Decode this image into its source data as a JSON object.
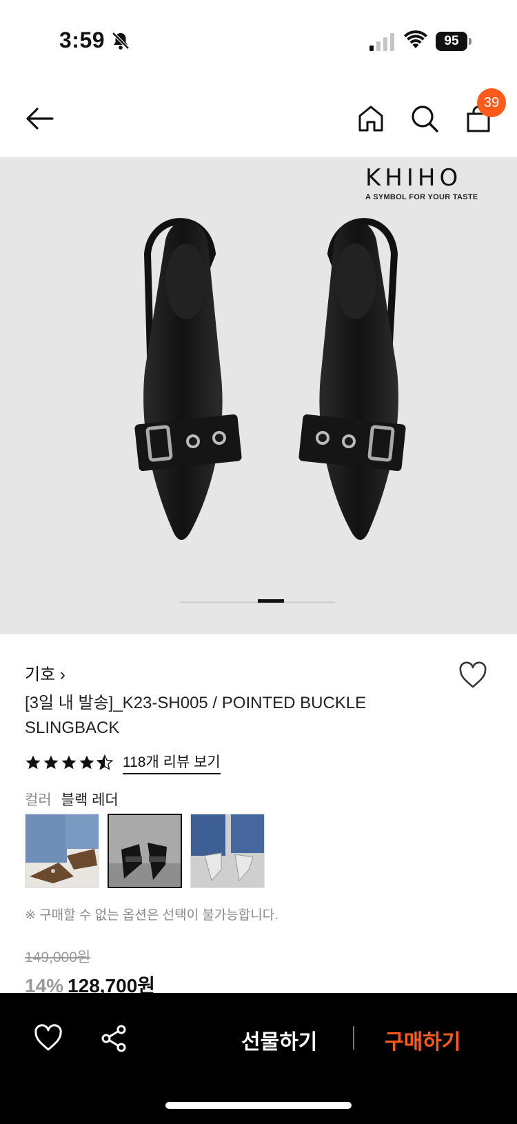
{
  "status": {
    "time": "3:59",
    "battery": "95"
  },
  "nav": {
    "cart_count": "39"
  },
  "hero": {
    "brand_logo": "KHIHO",
    "brand_tagline": "A SYMBOL FOR YOUR TASTE",
    "slide_count_note": "carousel"
  },
  "product": {
    "brand": "기호",
    "brand_chevron": "›",
    "title": "[3일 내 발송]_K23-SH005 / POINTED BUCKLE SLINGBACK",
    "rating": 4.5,
    "review_link": "118개 리뷰 보기",
    "color_label": "컬러",
    "color_value": "블랙 레더",
    "notice": "※ 구매할 수 없는 옵션은 선택이 불가능합니다.",
    "original_price": "149,000원",
    "discount": "14%",
    "sale_price": "128,700원"
  },
  "bottom": {
    "gift_label": "선물하기",
    "buy_label": "구매하기"
  },
  "colors": {
    "accent": "#ff5a1a",
    "bar_bg": "#000000",
    "muted": "#8a8a8a"
  }
}
